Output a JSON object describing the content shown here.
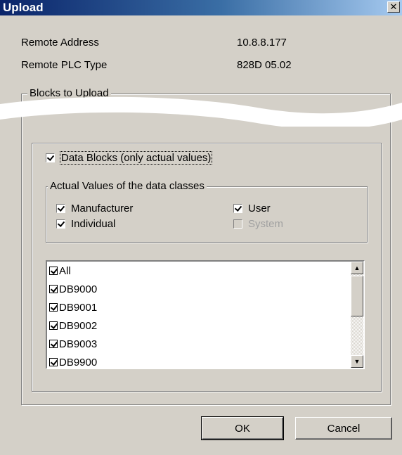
{
  "window": {
    "title": "Upload",
    "close_glyph": "✕"
  },
  "info": {
    "remote_address_label": "Remote Address",
    "remote_address_value": "10.8.8.177",
    "plc_type_label": "Remote PLC Type",
    "plc_type_value": "828D 05.02"
  },
  "blocks_group": {
    "legend": "Blocks to Upload"
  },
  "data_blocks": {
    "label": "Data Blocks (only actual values)",
    "checked": true
  },
  "data_classes": {
    "legend": "Actual Values of the data classes",
    "manufacturer": {
      "label": "Manufacturer",
      "checked": true
    },
    "individual": {
      "label": "Individual",
      "checked": true
    },
    "user": {
      "label": "User",
      "checked": true
    },
    "system": {
      "label": "System",
      "checked": false,
      "disabled": true
    }
  },
  "block_list": {
    "items": [
      {
        "label": "All",
        "checked": true
      },
      {
        "label": "DB9000",
        "checked": true
      },
      {
        "label": "DB9001",
        "checked": true
      },
      {
        "label": "DB9002",
        "checked": true
      },
      {
        "label": "DB9003",
        "checked": true
      },
      {
        "label": "DB9900",
        "checked": true
      }
    ]
  },
  "buttons": {
    "ok": "OK",
    "cancel": "Cancel"
  },
  "colors": {
    "title_bar": "#0a246a",
    "face": "#d4d0c8"
  }
}
